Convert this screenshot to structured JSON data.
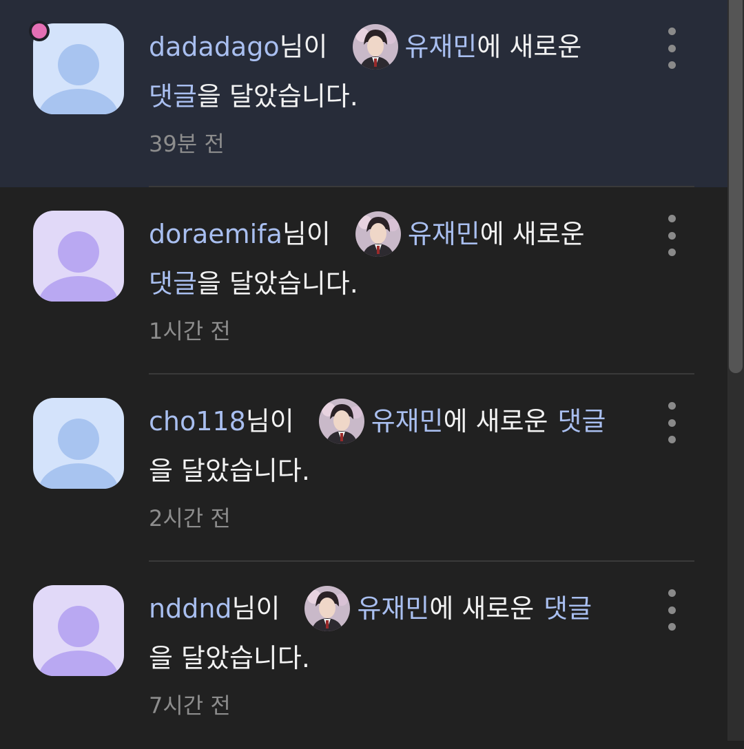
{
  "notifications": [
    {
      "username": "dadadago",
      "suffix_1": "님이",
      "post_title": "유재민",
      "suffix_2": "에 새로운",
      "comment_word": "댓글",
      "suffix_3": "을 달았습니다.",
      "time": "39분 전",
      "unread": true,
      "avatar_color": "#a8c4f0",
      "avatar_bg": "#d4e3fb"
    },
    {
      "username": "doraemifa",
      "suffix_1": "님이",
      "post_title": "유재민",
      "suffix_2": "에 새로운",
      "comment_word": "댓글",
      "suffix_3": "을 달았습니다.",
      "time": "1시간 전",
      "unread": false,
      "avatar_color": "#b9a8f2",
      "avatar_bg": "#e1d9f8"
    },
    {
      "username": "cho118",
      "suffix_1": "님이",
      "post_title": "유재민",
      "suffix_2": "에 새로운",
      "comment_word": "댓글",
      "suffix_3": "을 달았습니다.",
      "time": "2시간 전",
      "unread": false,
      "avatar_color": "#a8c4f0",
      "avatar_bg": "#d4e3fb"
    },
    {
      "username": "nddnd",
      "suffix_1": "님이",
      "post_title": "유재민",
      "suffix_2": "에 새로운",
      "comment_word": "댓글",
      "suffix_3": "을 달았습니다.",
      "time": "7시간 전",
      "unread": false,
      "avatar_color": "#b9a8f2",
      "avatar_bg": "#e1d9f8"
    }
  ],
  "colors": {
    "background": "#212121",
    "unread_background": "#272c39",
    "link": "#a9bff0",
    "text": "#f2f2f2",
    "timestamp": "#8d8d8d",
    "unread_dot": "#e46fb4"
  }
}
